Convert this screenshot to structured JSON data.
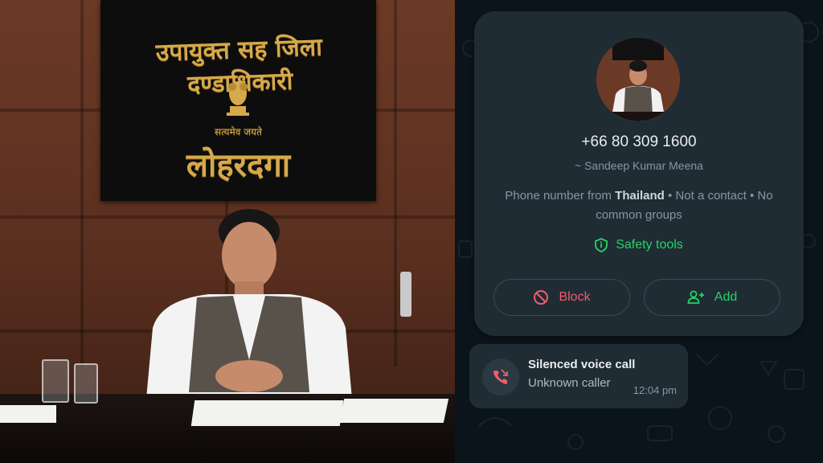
{
  "photo": {
    "nameplate_top": "उपायुक्त सह जिला दण्डाधिकारी",
    "nameplate_motto": "सत्यमेव जयते",
    "nameplate_city": "लोहरदगा"
  },
  "contact_card": {
    "phone_number": "+66 80 309 1600",
    "push_name": "~ Sandeep Kumar Meena",
    "info_prefix": "Phone number from ",
    "info_country": "Thailand",
    "info_suffix": " • Not a contact • No common groups",
    "safety_tools_label": "Safety tools",
    "block_label": "Block",
    "add_label": "Add"
  },
  "call_message": {
    "title": "Silenced voice call",
    "subtitle": "Unknown caller",
    "time": "12:04 pm"
  },
  "colors": {
    "accent_green": "#25d366",
    "danger_red": "#f15c6d",
    "card_bg": "#1f2c34",
    "chat_bg": "#0b141a"
  },
  "icons": [
    "ban-icon",
    "add-person-icon",
    "shield-icon",
    "missed-call-icon",
    "emblem-icon"
  ]
}
